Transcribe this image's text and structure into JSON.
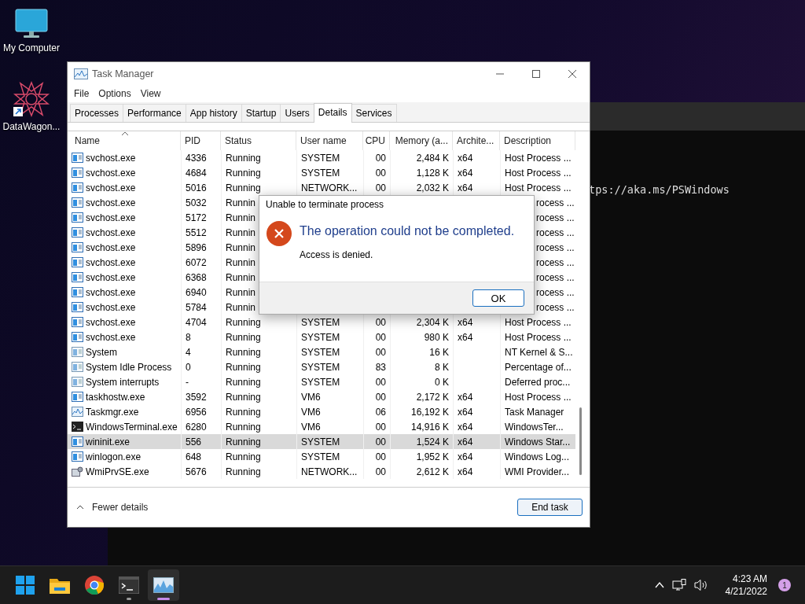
{
  "desktop_icons": [
    {
      "kind": "monitor",
      "label": "My Computer"
    },
    {
      "kind": "star",
      "label": "DataWagon..."
    }
  ],
  "terminal": {
    "visible_text": "tps://aka.ms/PSWindows"
  },
  "window": {
    "title": "Task Manager"
  },
  "menu": [
    "File",
    "Options",
    "View"
  ],
  "tabs": [
    {
      "label": "Processes",
      "selected": false
    },
    {
      "label": "Performance",
      "selected": false
    },
    {
      "label": "App history",
      "selected": false
    },
    {
      "label": "Startup",
      "selected": false
    },
    {
      "label": "Users",
      "selected": false
    },
    {
      "label": "Details",
      "selected": true
    },
    {
      "label": "Services",
      "selected": false
    }
  ],
  "table": {
    "columns": [
      "Name",
      "PID",
      "Status",
      "User name",
      "CPU",
      "Memory (a...",
      "Archite...",
      "Description"
    ],
    "rows": [
      {
        "kind": "service",
        "name": "svchost.exe",
        "pid": "4336",
        "status": "Running",
        "user": "SYSTEM",
        "cpu": "00",
        "memory": "2,484 K",
        "arch": "x64",
        "description": "Host Process ...",
        "selected": false
      },
      {
        "kind": "service",
        "name": "svchost.exe",
        "pid": "4684",
        "status": "Running",
        "user": "SYSTEM",
        "cpu": "00",
        "memory": "1,128 K",
        "arch": "x64",
        "description": "Host Process ...",
        "selected": false
      },
      {
        "kind": "service",
        "name": "svchost.exe",
        "pid": "5016",
        "status": "Running",
        "user": "NETWORK...",
        "cpu": "00",
        "memory": "2,032 K",
        "arch": "x64",
        "description": "Host Process ...",
        "selected": false
      },
      {
        "kind": "service",
        "name": "svchost.exe",
        "pid": "5032",
        "status": "Runnin",
        "description": "rocess ...",
        "selected": false
      },
      {
        "kind": "service",
        "name": "svchost.exe",
        "pid": "5172",
        "status": "Runnin",
        "description": "rocess ...",
        "selected": false
      },
      {
        "kind": "service",
        "name": "svchost.exe",
        "pid": "5512",
        "status": "Runnin",
        "description": "rocess ...",
        "selected": false
      },
      {
        "kind": "service",
        "name": "svchost.exe",
        "pid": "5896",
        "status": "Runnin",
        "description": "rocess ...",
        "selected": false
      },
      {
        "kind": "service",
        "name": "svchost.exe",
        "pid": "6072",
        "status": "Runnin",
        "description": "rocess ...",
        "selected": false
      },
      {
        "kind": "service",
        "name": "svchost.exe",
        "pid": "6368",
        "status": "Runnin",
        "description": "rocess ...",
        "selected": false
      },
      {
        "kind": "service",
        "name": "svchost.exe",
        "pid": "6940",
        "status": "Runnin",
        "description": "rocess ...",
        "selected": false
      },
      {
        "kind": "service",
        "name": "svchost.exe",
        "pid": "5784",
        "status": "Runnin",
        "description": "rocess ...",
        "selected": false
      },
      {
        "kind": "service",
        "name": "svchost.exe",
        "pid": "4704",
        "status": "Running",
        "user": "SYSTEM",
        "cpu": "00",
        "memory": "2,304 K",
        "arch": "x64",
        "description": "Host Process ...",
        "selected": false
      },
      {
        "kind": "service",
        "name": "svchost.exe",
        "pid": "8",
        "status": "Running",
        "user": "SYSTEM",
        "cpu": "00",
        "memory": "980 K",
        "arch": "x64",
        "description": "Host Process ...",
        "selected": false
      },
      {
        "kind": "system",
        "name": "System",
        "pid": "4",
        "status": "Running",
        "user": "SYSTEM",
        "cpu": "00",
        "memory": "16 K",
        "description": "NT Kernel & S...",
        "selected": false
      },
      {
        "kind": "system",
        "name": "System Idle Process",
        "pid": "0",
        "status": "Running",
        "user": "SYSTEM",
        "cpu": "83",
        "memory": "8 K",
        "description": "Percentage of...",
        "selected": false
      },
      {
        "kind": "system",
        "name": "System interrupts",
        "pid": "-",
        "status": "Running",
        "user": "SYSTEM",
        "cpu": "00",
        "memory": "0 K",
        "description": "Deferred proc...",
        "selected": false
      },
      {
        "kind": "service",
        "name": "taskhostw.exe",
        "pid": "3592",
        "status": "Running",
        "user": "VM6",
        "cpu": "00",
        "memory": "2,172 K",
        "arch": "x64",
        "description": "Host Process ...",
        "selected": false
      },
      {
        "kind": "chart",
        "name": "Taskmgr.exe",
        "pid": "6956",
        "status": "Running",
        "user": "VM6",
        "cpu": "06",
        "memory": "16,192 K",
        "arch": "x64",
        "description": "Task Manager",
        "selected": false
      },
      {
        "kind": "console",
        "name": "WindowsTerminal.exe",
        "pid": "6280",
        "status": "Running",
        "user": "VM6",
        "cpu": "00",
        "memory": "14,916 K",
        "arch": "x64",
        "description": "WindowsTer...",
        "selected": false
      },
      {
        "kind": "service",
        "name": "wininit.exe",
        "pid": "556",
        "status": "Running",
        "user": "SYSTEM",
        "cpu": "00",
        "memory": "1,524 K",
        "arch": "x64",
        "description": "Windows Star...",
        "selected": true
      },
      {
        "kind": "service",
        "name": "winlogon.exe",
        "pid": "648",
        "status": "Running",
        "user": "SYSTEM",
        "cpu": "00",
        "memory": "1,952 K",
        "arch": "x64",
        "description": "Windows Log...",
        "selected": false
      },
      {
        "kind": "wmi",
        "name": "WmiPrvSE.exe",
        "pid": "5676",
        "status": "Running",
        "user": "NETWORK...",
        "cpu": "00",
        "memory": "2,612 K",
        "arch": "x64",
        "description": "WMI Provider...",
        "selected": false
      }
    ]
  },
  "footer": {
    "toggle": "Fewer details",
    "button": "End task"
  },
  "dialog": {
    "title": "Unable to terminate process",
    "heading": "The operation could not be completed.",
    "message": "Access is denied.",
    "button": "OK"
  },
  "taskbar": {
    "apps": [
      {
        "kind": "start",
        "running": false,
        "active": false
      },
      {
        "kind": "folder",
        "running": false,
        "active": false
      },
      {
        "kind": "browser",
        "running": false,
        "active": false
      },
      {
        "kind": "terminal",
        "running": true,
        "active": false
      },
      {
        "kind": "taskmgr",
        "running": true,
        "active": true
      }
    ],
    "time": "4:23 AM",
    "date": "4/21/2022",
    "notifications": "1"
  }
}
